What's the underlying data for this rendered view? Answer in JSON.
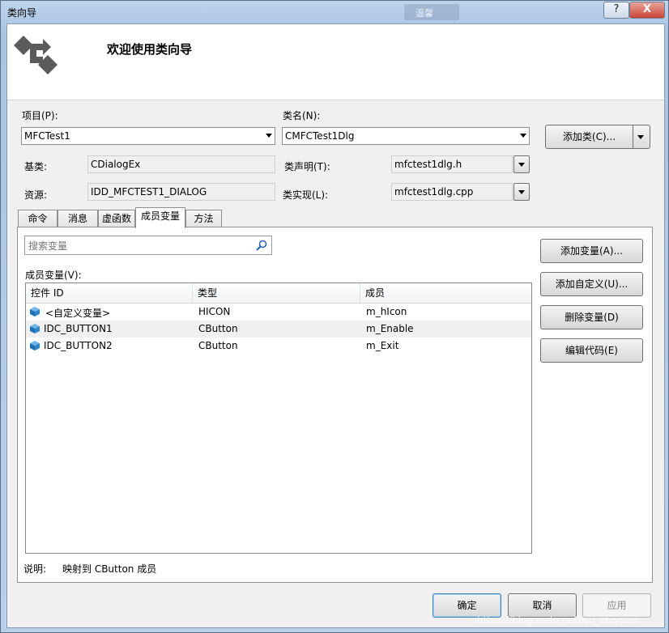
{
  "window": {
    "title": "类向导",
    "blurred_title_text": "温馨",
    "help_label": "?",
    "close_label": "X"
  },
  "banner": {
    "title": "欢迎使用类向导"
  },
  "project": {
    "label": "项目(P):",
    "value": "MFCTest1"
  },
  "class_name": {
    "label": "类名(N):",
    "value": "CMFCTest1Dlg"
  },
  "add_class_button": "添加类(C)...",
  "base_class": {
    "label": "基类:",
    "value": "CDialogEx"
  },
  "class_declaration": {
    "label": "类声明(T):",
    "value": "mfctest1dlg.h"
  },
  "resource": {
    "label": "资源:",
    "value": "IDD_MFCTEST1_DIALOG"
  },
  "class_implementation": {
    "label": "类实现(L):",
    "value": "mfctest1dlg.cpp"
  },
  "tabs": [
    "命令",
    "消息",
    "虚函数",
    "成员变量",
    "方法"
  ],
  "active_tab": "成员变量",
  "search": {
    "placeholder": "搜索变量"
  },
  "member_list": {
    "label": "成员变量(V):",
    "columns": [
      "控件 ID",
      "类型",
      "成员"
    ],
    "rows": [
      {
        "id": "<自定义变量>",
        "type": "HICON",
        "member": "m_hIcon"
      },
      {
        "id": "IDC_BUTTON1",
        "type": "CButton",
        "member": "m_Enable"
      },
      {
        "id": "IDC_BUTTON2",
        "type": "CButton",
        "member": "m_Exit"
      }
    ]
  },
  "side_buttons": [
    "添加变量(A)...",
    "添加自定义(U)...",
    "删除变量(D)",
    "编辑代码(E)"
  ],
  "description": {
    "label": "说明:",
    "value": "映射到 CButton 成员"
  },
  "footer_buttons": {
    "ok": "确定",
    "cancel": "取消",
    "apply": "应用"
  },
  "watermark": "https://blog.csdn.net/wu_zhiyuan"
}
